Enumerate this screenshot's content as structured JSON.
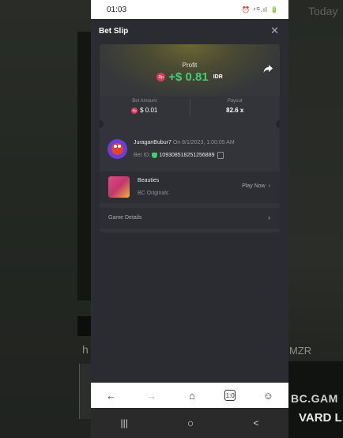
{
  "status_bar": {
    "time": "01:03",
    "icons": "⏰ ⁴ᴳ.ıl 🔋"
  },
  "background": {
    "today": "Today",
    "left_text": "h",
    "right_text": "MZR",
    "brand": "BC.GAM",
    "promo": "VARD L"
  },
  "header": {
    "title": "Bet Slip"
  },
  "profit": {
    "label": "Profit",
    "coin": "Rp",
    "amount": "+$ 0.81",
    "currency": "IDR"
  },
  "stats": [
    {
      "label": "Bet Amount",
      "value": "$ 0.01",
      "coin": "Rp"
    },
    {
      "label": "Payout",
      "value": "82.6 x"
    }
  ],
  "user": {
    "name": "JuraganBubur7",
    "date_text": "On 8/1/2023, 1:00:05 AM",
    "bet_id_label": "Bet ID:",
    "bet_id": "109308518251256889"
  },
  "game": {
    "name": "Beauties",
    "provider": "BC Originals",
    "action": "Play Now"
  },
  "details": {
    "label": "Game Details"
  },
  "browser_nav": [
    "←",
    "→",
    "⌂",
    "1:0",
    "☺"
  ],
  "android_nav": [
    "|||",
    "○",
    "<"
  ],
  "colors": {
    "profit_green": "#3bd16f",
    "coin_red": "#e13a58",
    "panel": "#2a2c31"
  }
}
